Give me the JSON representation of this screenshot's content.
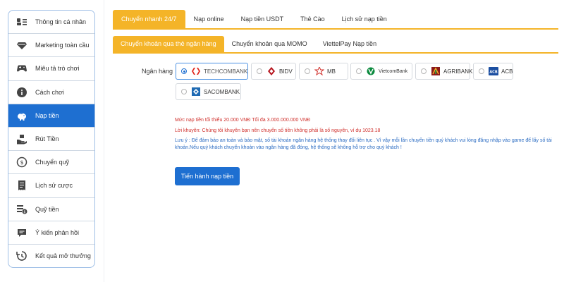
{
  "sidebar": {
    "items": [
      {
        "label": "Thông tin cá nhân",
        "icon": "id-card-icon",
        "active": false
      },
      {
        "label": "Marketing toàn cầu",
        "icon": "diamond-icon",
        "active": false
      },
      {
        "label": "Miêu tả trò chơi",
        "icon": "gamepad-icon",
        "active": false
      },
      {
        "label": "Cách chơi",
        "icon": "info-icon",
        "active": false
      },
      {
        "label": "Nạp tiền",
        "icon": "piggy-bank-icon",
        "active": true
      },
      {
        "label": "Rút Tiền",
        "icon": "money-hand-icon",
        "active": false
      },
      {
        "label": "Chuyển quỹ",
        "icon": "dollar-circle-icon",
        "active": false
      },
      {
        "label": "Lịch sử cược",
        "icon": "receipt-icon",
        "active": false
      },
      {
        "label": "Quỹ tiền",
        "icon": "fund-icon",
        "active": false
      },
      {
        "label": "Ý kiến phản hồi",
        "icon": "chat-icon",
        "active": false
      },
      {
        "label": "Kết quả mở thưởng",
        "icon": "history-icon",
        "active": false
      }
    ]
  },
  "tabs_primary": [
    {
      "label": "Chuyển nhanh 24/7",
      "active": true
    },
    {
      "label": "Nạp online",
      "active": false
    },
    {
      "label": "Nạp tiền USDT",
      "active": false
    },
    {
      "label": "Thẻ Cào",
      "active": false
    },
    {
      "label": "Lịch sử nạp tiền",
      "active": false
    }
  ],
  "tabs_secondary": [
    {
      "label": "Chuyển khoản qua thẻ ngân hàng",
      "active": true
    },
    {
      "label": "Chuyển khoản qua MOMO",
      "active": false
    },
    {
      "label": "ViettelPay Nạp tiền",
      "active": false
    }
  ],
  "bank_section": {
    "label": "Ngân hàng",
    "banks": [
      {
        "name": "TECHCOMBANK",
        "logo": "techcombank-logo-icon",
        "selected": true
      },
      {
        "name": "BIDV",
        "logo": "bidv-logo-icon",
        "selected": false
      },
      {
        "name": "MB",
        "logo": "mb-logo-icon",
        "selected": false
      },
      {
        "name": "VietcomBank",
        "logo": "vietcombank-logo-icon",
        "selected": false
      },
      {
        "name": "AGRIBANK",
        "logo": "agribank-logo-icon",
        "selected": false
      },
      {
        "name": "ACB",
        "logo": "acb-logo-icon",
        "selected": false
      },
      {
        "name": "SACOMBANK",
        "logo": "sacombank-logo-icon",
        "selected": false
      }
    ]
  },
  "notes": {
    "limit": "Mức nạp tiền tối thiểu 20.000 VNĐ Tối đa 3.000.000.000 VNĐ",
    "promo": "Lời khuyên: Chúng tôi khuyên bạn nên chuyển số tiền không phải là số nguyên, ví dụ 1023.18",
    "warning": "Lưu ý : Để đảm bảo an toàn và bảo mật, số tài khoản ngân hàng hệ thống thay đổi liên tục . Vì vậy mỗi lần chuyển tiền quý khách vui lòng đăng nhập vào game để lấy số tài khoản.Nếu quý khách chuyển khoản vào ngân hàng đã đóng, hệ thống sẽ không hỗ trợ cho quý khách !"
  },
  "submit_label": "Tiến hành nạp tiền",
  "colors": {
    "accent": "#f4b428",
    "primary": "#1e6fd1",
    "error": "#d0312d",
    "info": "#2a6bc2"
  }
}
